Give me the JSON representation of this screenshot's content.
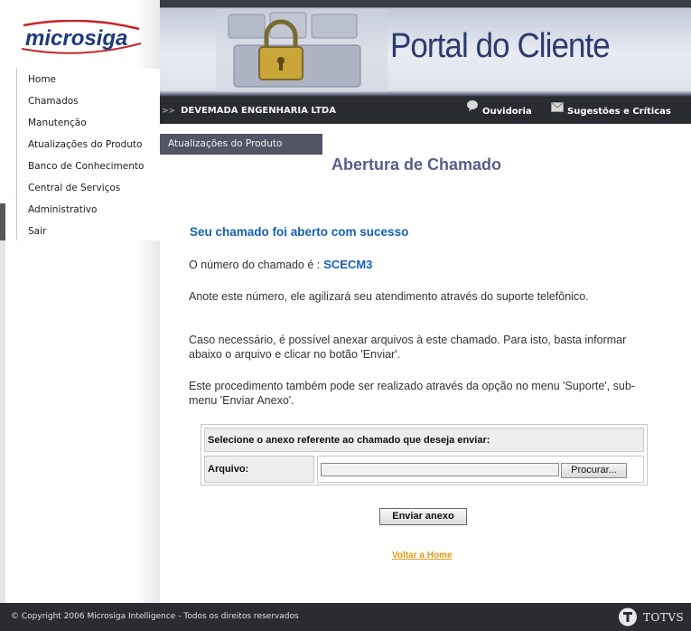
{
  "brand": {
    "logo_text": "microsiga"
  },
  "nav": {
    "items": [
      {
        "label": "Home"
      },
      {
        "label": "Chamados"
      },
      {
        "label": "Manutenção"
      },
      {
        "label": "Atualizações do Produto"
      },
      {
        "label": "Banco de Conhecimento"
      },
      {
        "label": "Central de Serviços"
      },
      {
        "label": "Administrativo"
      },
      {
        "label": "Sair"
      }
    ]
  },
  "banner": {
    "title": "Portal do Cliente"
  },
  "topbar": {
    "company_arrow": ">>",
    "company": "DEVEMADA ENGENHARIA LTDA",
    "ouvidoria": "Ouvidoria",
    "sugestoes": "Sugestões e Críticas"
  },
  "breadcrumb": "Atualizações do Produto",
  "main": {
    "title": "Abertura de Chamado",
    "success_message": "Seu chamado foi aberto com sucesso",
    "ticket_label": "O número do chamado é :",
    "ticket_number": "SCECM3",
    "note": "Anote este número, ele agilizará seu atendimento através do suporte telefônico.",
    "attach_info": "Caso necessário, é possível anexar arquivos à este chamado. Para isto, basta informar abaixo o arquivo e clicar no botão 'Enviar'.",
    "menu_info": "Este procedimento também pode ser realizado através da opção no menu 'Suporte', sub-menu 'Enviar Anexo'."
  },
  "upload": {
    "header": "Selecione o anexo referente ao chamado que deseja enviar:",
    "field_label": "Arquivo:",
    "file_value": "",
    "browse_label": "Procurar..."
  },
  "actions": {
    "send_label": "Enviar anexo",
    "home_link": "Voltar a Home"
  },
  "footer": {
    "copyright": "© Copyright 2006 Microsiga Intelligence - Todos os direitos reservados",
    "totvs": "TOTVS"
  },
  "colors": {
    "accent_blue": "#1560b4",
    "title_purple": "#5a5d8a",
    "link_orange": "#e09a16",
    "bar_dark": "#2a2c31"
  }
}
